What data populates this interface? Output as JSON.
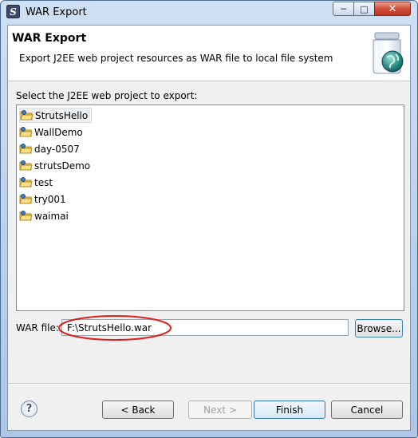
{
  "window": {
    "title": "WAR Export",
    "app_icon": "eclipse-icon",
    "controls": {
      "minimize": "─",
      "maximize": "□",
      "close": "✕"
    }
  },
  "banner": {
    "title": "WAR Export",
    "description": "Export J2EE web project resources as WAR file to local file system",
    "image_icon": "war-export-jar-globe-icon"
  },
  "project_section": {
    "label": "Select the J2EE web project to export:",
    "projects": [
      {
        "name": "StrutsHello",
        "selected": true
      },
      {
        "name": "WallDemo",
        "selected": false
      },
      {
        "name": "day-0507",
        "selected": false
      },
      {
        "name": "strutsDemo",
        "selected": false
      },
      {
        "name": "test",
        "selected": false
      },
      {
        "name": "try001",
        "selected": false
      },
      {
        "name": "waimai",
        "selected": false
      }
    ],
    "item_icon": "web-project-folder-icon"
  },
  "war_file": {
    "label": "WAR file:",
    "value": "F:\\StrutsHello.war",
    "browse_label": "Browse..."
  },
  "footer": {
    "help_icon": "help-icon",
    "help_glyph": "?",
    "back_label": "< Back",
    "next_label": "Next >",
    "finish_label": "Finish",
    "cancel_label": "Cancel"
  },
  "colors": {
    "annotation_red": "#e0201a",
    "title_bar": "#b9d0ea",
    "dialog_bg": "#f0f0f0"
  }
}
